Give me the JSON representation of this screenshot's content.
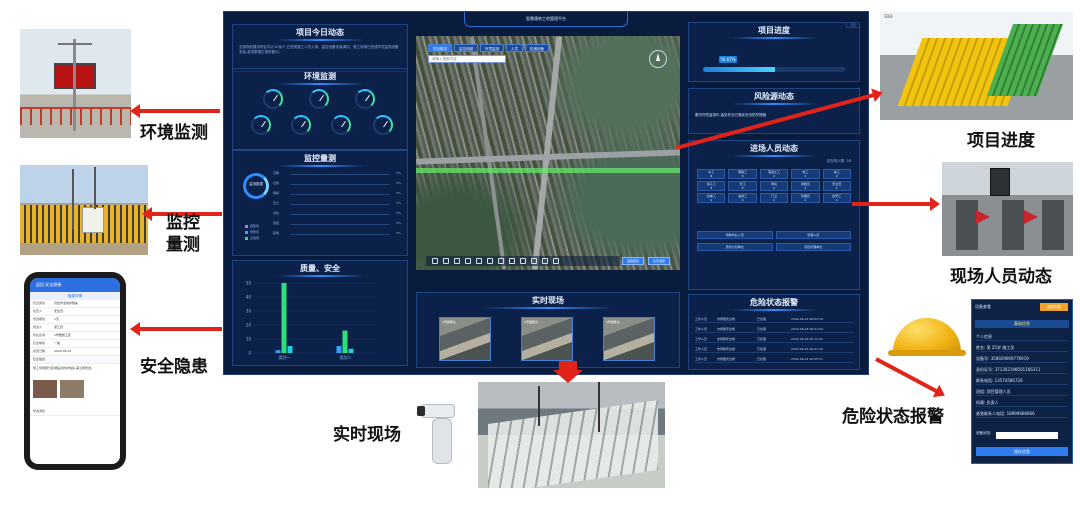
{
  "dashboard": {
    "title": "智慧建筑工地管理平台",
    "back": "返回",
    "project_news": {
      "title": "项目今日动态",
      "text": "全部规划建设项目共计10余个,已完成施工人员入场、监控设备安装调试。施工现场已完成环境监测设备安装,各项数据正常采集中。"
    },
    "env": {
      "title": "环境监测"
    },
    "monitor": {
      "title": "监控量测",
      "donut": "监测数据",
      "rows": [
        {
          "label": "沉降",
          "pct": "0%"
        },
        {
          "label": "位移",
          "pct": "0%"
        },
        {
          "label": "倾斜",
          "pct": "0%"
        },
        {
          "label": "应力",
          "pct": "0%"
        },
        {
          "label": "水位",
          "pct": "0%"
        },
        {
          "label": "裂缝",
          "pct": "0%"
        },
        {
          "label": "其他",
          "pct": "0%"
        }
      ],
      "legend": [
        "报警值",
        "预警值",
        "正常值"
      ]
    },
    "quality": {
      "title": "质量、安全",
      "chart_data": {
        "type": "bar",
        "categories": [
          "类别一",
          "类别二"
        ],
        "series": [
          {
            "values": [
              2,
              5
            ]
          },
          {
            "values": [
              50,
              16
            ]
          },
          {
            "values": [
              5,
              3
            ]
          }
        ],
        "ylim": [
          0,
          50
        ],
        "yticks": [
          "50",
          "40",
          "30",
          "20",
          "10",
          "0"
        ]
      }
    },
    "map": {
      "tabs": [
        "项目概况",
        "监控视频",
        "环境监测",
        "人员",
        "机械设备"
      ],
      "search_placeholder": "请输入搜索内容",
      "btn_left": "返回首页",
      "btn_right": "全景漫游"
    },
    "live": {
      "title": "实时现场",
      "cams": [
        "1号摄像头",
        "2号摄像头",
        "3号摄像头"
      ]
    },
    "progress": {
      "title": "项目进度",
      "percent_label": "50.67%",
      "value": 0.5067
    },
    "risk": {
      "title": "风险源动态",
      "text": "基坑开挖监测中,高处作业已落实安全防护措施"
    },
    "personnel": {
      "title": "进场人员动态",
      "total": "总在场人数: 28",
      "cells": [
        {
          "k": "木工",
          "v": "4"
        },
        {
          "k": "钢筋工",
          "v": "3"
        },
        {
          "k": "混凝土工",
          "v": "2"
        },
        {
          "k": "电工",
          "v": "1"
        },
        {
          "k": "焊工",
          "v": "2"
        },
        {
          "k": "架子工",
          "v": "3"
        },
        {
          "k": "普工",
          "v": "5"
        },
        {
          "k": "司机",
          "v": "2"
        },
        {
          "k": "测量员",
          "v": "1"
        },
        {
          "k": "安全员",
          "v": "1"
        },
        {
          "k": "机械工",
          "v": "1"
        },
        {
          "k": "油漆工",
          "v": "0"
        },
        {
          "k": "门卫",
          "v": "1"
        },
        {
          "k": "管理员",
          "v": "1"
        },
        {
          "k": "信号工",
          "v": "1"
        }
      ],
      "wide": [
        [
          "特种作业人员",
          "管理人员"
        ],
        [
          "劳务分包单位",
          "项目管理单位"
        ]
      ]
    },
    "alarm": {
      "title": "危险状态报警",
      "rows": [
        {
          "name": "工作人员",
          "type": "未佩戴安全帽",
          "status": "已处理",
          "time": "2020-06-22 08:24:18"
        },
        {
          "name": "工作人员",
          "type": "未佩戴安全帽",
          "status": "已处理",
          "time": "2020-06-22 08:31:02"
        },
        {
          "name": "工作人员",
          "type": "未佩戴安全帽",
          "status": "已处理",
          "time": "2020-06-22 09:12:45"
        },
        {
          "name": "工作人员",
          "type": "未佩戴安全帽",
          "status": "已处理",
          "time": "2020-06-22 09:47:30"
        },
        {
          "name": "工作人员",
          "type": "未佩戴安全帽",
          "status": "已处理",
          "time": "2020-06-22 10:05:11"
        }
      ]
    }
  },
  "captions": {
    "env": "环境监测",
    "monitor_1": "监控",
    "monitor_2": "量测",
    "safety": "安全隐患",
    "progress": "项目进度",
    "personnel": "现场人员动态",
    "live": "实时现场",
    "alarm": "危险状态报警"
  },
  "phone": {
    "title": "返回 安全隐患",
    "subtitle": "隐患详情",
    "rows": [
      {
        "k": "隐患类别",
        "v": "高处作业防护缺失"
      },
      {
        "k": "检查人",
        "v": "安全员"
      },
      {
        "k": "整改期限",
        "v": "1天"
      },
      {
        "k": "整改人",
        "v": "施工员"
      },
      {
        "k": "所在区域",
        "v": "1号楼施工区"
      },
      {
        "k": "隐患等级",
        "v": "一般"
      },
      {
        "k": "检查日期",
        "v": "2020-06-22"
      }
    ],
    "desc_title": "隐患描述",
    "desc": "施工现场部分区域临边防护缺失,需立即整改。",
    "footer": "整改通知"
  },
  "card": {
    "header": "设备查看",
    "btn": "返回列表",
    "tab": "基础信息",
    "lines": [
      "个人信息",
      "姓名: 男 25岁 施工员",
      "设备号: 358929069776919",
      "身份证号: 371302198501166311",
      "联系电话: 13574586726",
      "班组: 项目管理人员",
      "所属: 负责人",
      "紧急联系人电话: 18999666666"
    ],
    "select_label": "设备状态:",
    "save": "保存信息"
  },
  "colors": {
    "arrow": "#e2231a",
    "dash_bg": "#0a1c3e",
    "accent": "#2f7cf0",
    "bar_blue": "#3aa0ff",
    "bar_green": "#2ee07a",
    "bar_cyan": "#22d0e0"
  }
}
